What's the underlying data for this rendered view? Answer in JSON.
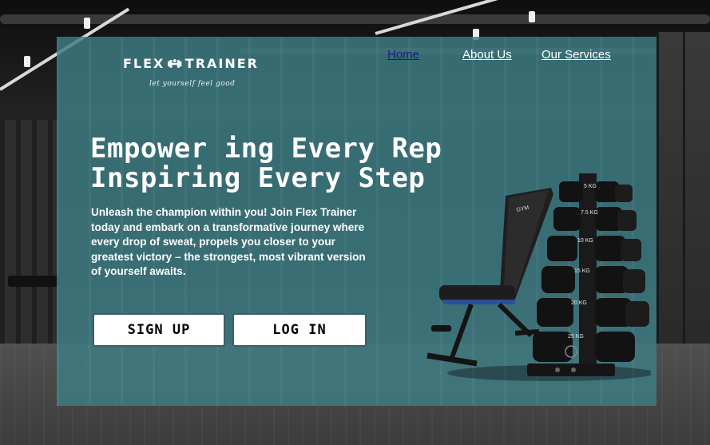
{
  "brand": {
    "name_left": "FLEX",
    "name_right": "TRAINER",
    "tagline": "let yourself feel good",
    "icon": "dumbbell-icon"
  },
  "nav": {
    "items": [
      {
        "label": "Home",
        "active": true
      },
      {
        "label": "About Us",
        "active": false
      },
      {
        "label": "Our Services",
        "active": false
      }
    ]
  },
  "hero": {
    "headline_line1": "Empower ing Every Rep",
    "headline_line2": "Inspiring Every Step",
    "description": "Unleash the champion within you! Join Flex Trainer today and embark on a transformative journey where every drop of sweat, propels you closer to your greatest victory – the strongest, most vibrant version of yourself awaits.",
    "signup_label": "SIGN UP",
    "login_label": "LOG IN"
  },
  "equipment": {
    "bench_brand": "GYM",
    "dumbbell_labels": [
      "5 KG",
      "7.5 KG",
      "10 KG",
      "15 KG",
      "20 KG",
      "25 KG"
    ]
  },
  "colors": {
    "panel": "#3e7e86",
    "active_nav": "#1a1a8c",
    "button_bg": "#ffffff"
  }
}
